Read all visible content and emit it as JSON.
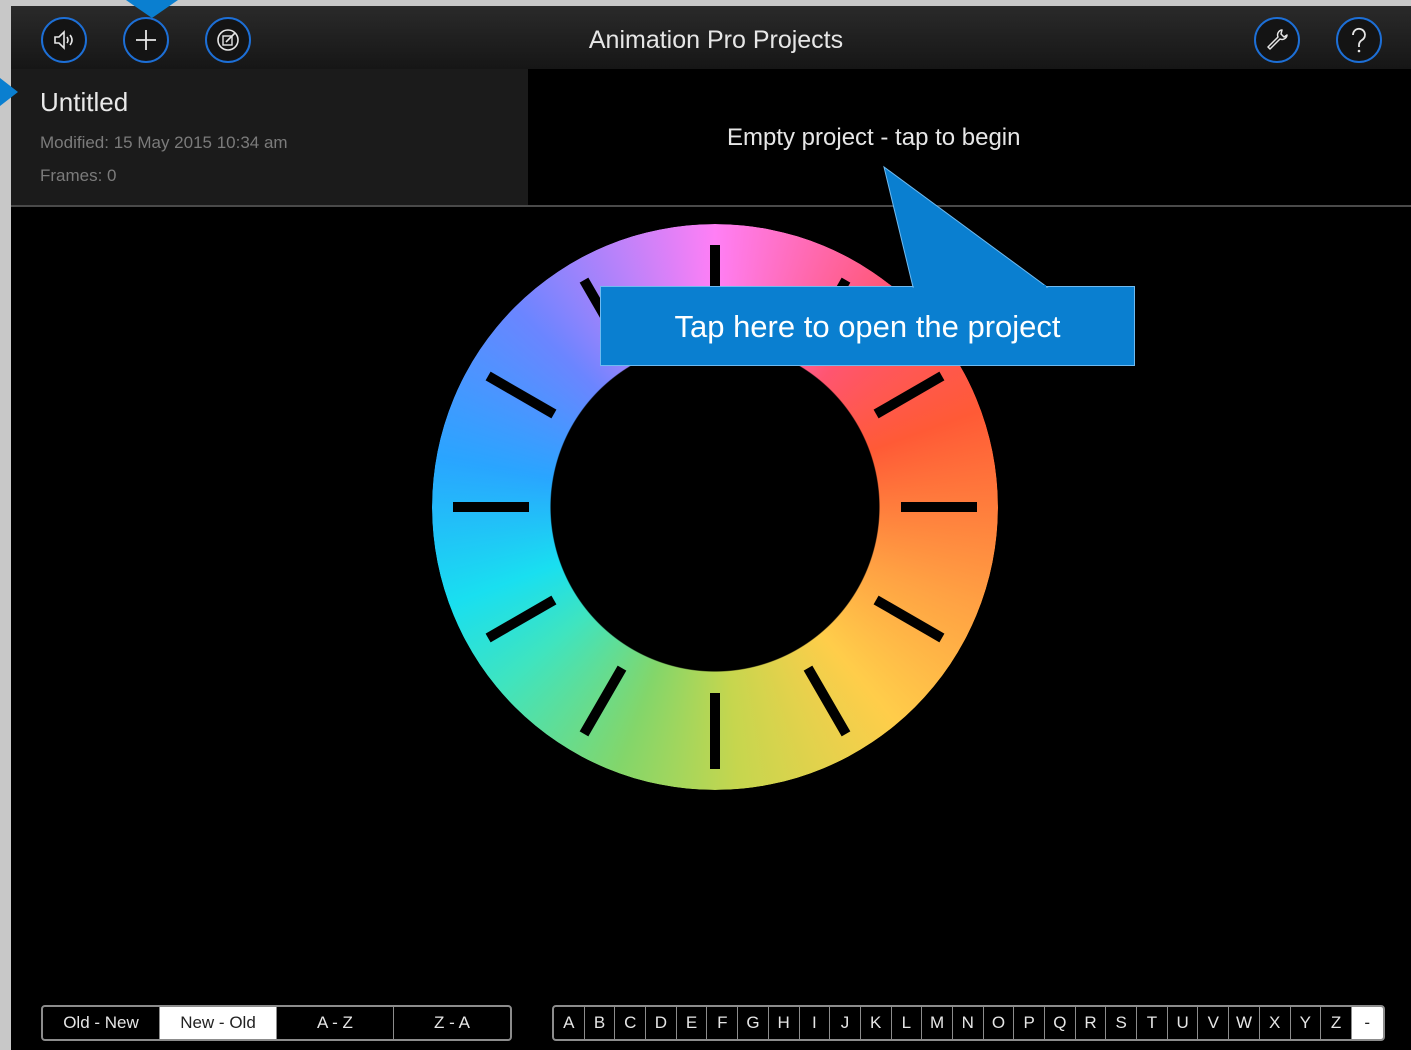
{
  "header": {
    "title": "Animation Pro Projects",
    "buttons": {
      "sound": "speaker-icon",
      "add": "plus-icon",
      "edit": "edit-icon",
      "settings": "wrench-icon",
      "help": "question-icon"
    }
  },
  "project": {
    "name": "Untitled",
    "modified": "Modified: 15 May 2015 10:34 am",
    "frames": "Frames: 0",
    "empty_hint": "Empty project - tap to begin"
  },
  "callout": {
    "text": "Tap here to open the project"
  },
  "sort": {
    "options": [
      "Old - New",
      "New - Old",
      "A - Z",
      "Z - A"
    ],
    "selected": "New - Old"
  },
  "alphabet": [
    "A",
    "B",
    "C",
    "D",
    "E",
    "F",
    "G",
    "H",
    "I",
    "J",
    "K",
    "L",
    "M",
    "N",
    "O",
    "P",
    "Q",
    "R",
    "S",
    "T",
    "U",
    "V",
    "W",
    "X",
    "Y",
    "Z",
    "-"
  ],
  "colors": {
    "accent": "#1d6fd6",
    "callout": "#0a7fd0"
  }
}
